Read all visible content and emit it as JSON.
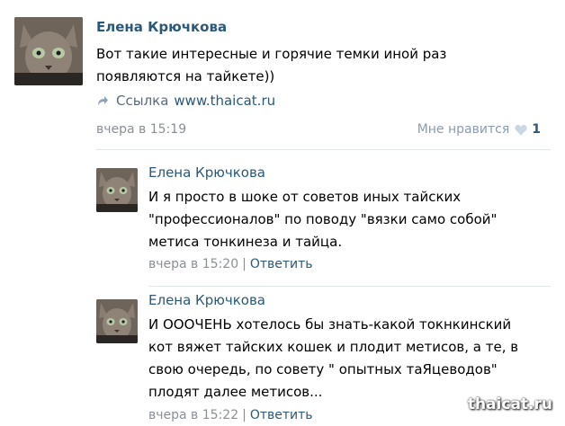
{
  "post": {
    "author": "Елена Крючкова",
    "text_lines": [
      "Вот такие интересные и горячие темки иной раз",
      "появляются на тайкете))"
    ],
    "link_label": "Ссылка",
    "link_url": "www.thaicat.ru",
    "date": "вчера в 15:19",
    "like_label": "Мне нравится",
    "like_count": "1"
  },
  "comments": [
    {
      "author": "Елена Крючкова",
      "text_lines": [
        "И я просто в шоке от советов иных тайских",
        "\"профессионалов\" по поводу \"вязки само собой\"",
        "метиса тонкинеза и тайца."
      ],
      "date": "вчера в 15:20",
      "separator": "|",
      "reply_label": "Ответить"
    },
    {
      "author": "Елена Крючкова",
      "text_lines": [
        "И ОООЧЕНЬ хотелось бы знать-какой токнкинский",
        "кот вяжет тайских кошек и плодит метисов, а те, в",
        "свою очередь, по совету \" опытных таЯцеводов\"",
        "плодят далее метисов..."
      ],
      "date": "вчера в 15:22",
      "separator": "|",
      "reply_label": "Ответить"
    }
  ],
  "watermark": "thaicat.ru",
  "colors": {
    "name": "#2b587a",
    "meta": "#8a8f96",
    "link": "#2b587a"
  },
  "icons": {
    "link": "share-arrow-icon",
    "like": "heart-icon"
  }
}
